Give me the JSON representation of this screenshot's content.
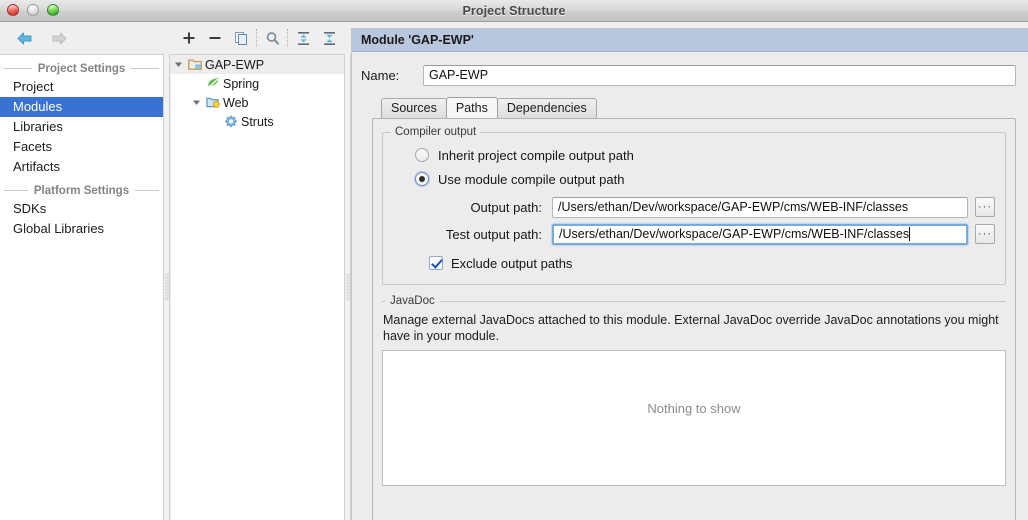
{
  "window": {
    "title": "Project Structure"
  },
  "toolbar": {
    "back": "back-arrow",
    "forward": "forward-arrow",
    "add": "+",
    "remove": "−",
    "copy": "copy-icon",
    "find": "search-icon",
    "expand_all": "expand-all-icon",
    "collapse_all": "collapse-all-icon"
  },
  "sidebar": {
    "groups": [
      {
        "label": "Project Settings",
        "items": [
          {
            "label": "Project",
            "selected": false
          },
          {
            "label": "Modules",
            "selected": true
          },
          {
            "label": "Libraries",
            "selected": false
          },
          {
            "label": "Facets",
            "selected": false
          },
          {
            "label": "Artifacts",
            "selected": false
          }
        ]
      },
      {
        "label": "Platform Settings",
        "items": [
          {
            "label": "SDKs",
            "selected": false
          },
          {
            "label": "Global Libraries",
            "selected": false
          }
        ]
      }
    ]
  },
  "tree": {
    "nodes": [
      {
        "label": "GAP-EWP",
        "icon": "module-folder-icon",
        "depth": 0,
        "expanded": true,
        "selected": true
      },
      {
        "label": "Spring",
        "icon": "spring-leaf-icon",
        "depth": 1,
        "expanded": null,
        "selected": false
      },
      {
        "label": "Web",
        "icon": "web-facet-icon",
        "depth": 1,
        "expanded": true,
        "selected": false
      },
      {
        "label": "Struts",
        "icon": "struts-gear-icon",
        "depth": 2,
        "expanded": null,
        "selected": false
      }
    ]
  },
  "detail": {
    "header": "Module 'GAP-EWP'",
    "name_label": "Name:",
    "name_value": "GAP-EWP",
    "tabs": [
      {
        "label": "Sources",
        "active": false
      },
      {
        "label": "Paths",
        "active": true
      },
      {
        "label": "Dependencies",
        "active": false
      }
    ],
    "compiler_output": {
      "group_title": "Compiler output",
      "radio_inherit": "Inherit project compile output path",
      "radio_module": "Use module compile output path",
      "radio_selected": "module",
      "output_label": "Output path:",
      "output_value": "/Users/ethan/Dev/workspace/GAP-EWP/cms/WEB-INF/classes",
      "test_output_label": "Test output path:",
      "test_output_value": "/Users/ethan/Dev/workspace/GAP-EWP/cms/WEB-INF/classes",
      "browse_label": "···",
      "exclude_label": "Exclude output paths",
      "exclude_checked": true
    },
    "javadoc": {
      "group_title": "JavaDoc",
      "description": "Manage external JavaDocs attached to this module. External JavaDoc override JavaDoc annotations you might have in your module.",
      "empty_text": "Nothing to show"
    }
  },
  "colors": {
    "selection_blue": "#3a72d1",
    "header_blue": "#b9c7de",
    "focus_blue": "#79aadd",
    "window_bg": "#ececec"
  }
}
